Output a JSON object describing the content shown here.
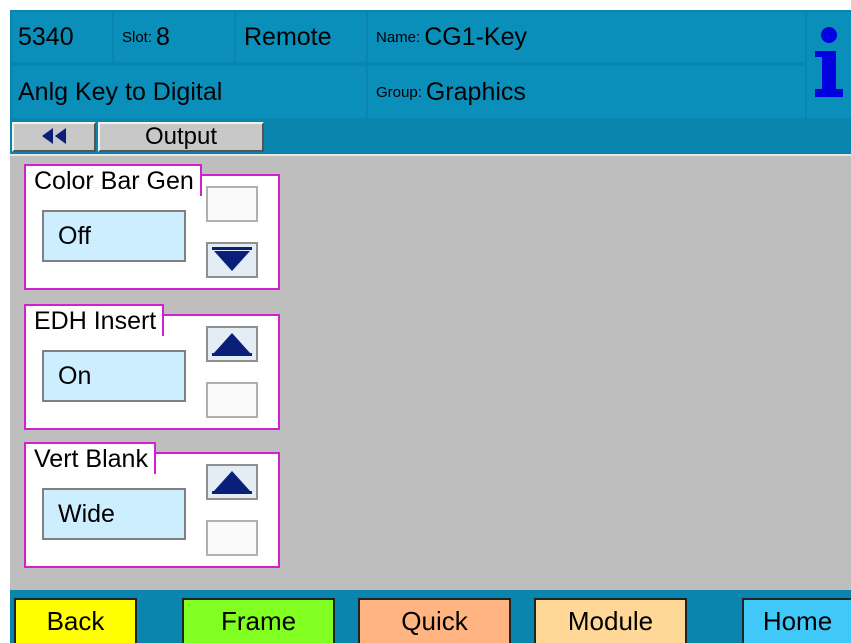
{
  "header": {
    "model": "5340",
    "slot_label": "Slot:",
    "slot_value": "8",
    "mode": "Remote",
    "name_label": "Name:",
    "name_value": "CG1-Key",
    "description": "Anlg Key to Digital",
    "group_label": "Group:",
    "group_value": "Graphics",
    "info_glyph": "i"
  },
  "nav": {
    "back_icon": "double-left-arrow-icon",
    "current_page": "Output"
  },
  "controls": [
    {
      "label": "Color Bar Gen",
      "value": "Off",
      "arrows": [
        "down"
      ]
    },
    {
      "label": "EDH Insert",
      "value": "On",
      "arrows": [
        "up"
      ]
    },
    {
      "label": "Vert Blank",
      "value": "Wide",
      "arrows": [
        "up"
      ]
    }
  ],
  "bottom_nav": [
    {
      "label": "Back",
      "color": "#ffff00"
    },
    {
      "label": "Frame",
      "color": "#80ff20"
    },
    {
      "label": "Quick",
      "color": "#ffb482"
    },
    {
      "label": "Module",
      "color": "#ffd898"
    },
    {
      "label": "Home",
      "color": "#40c8f8"
    }
  ],
  "colors": {
    "header_bg": "#0a8fba",
    "panel_bg": "#bebebe",
    "value_box": "#cceeff",
    "group_border": "#d020d0",
    "arrow": "#0a1f7a"
  }
}
